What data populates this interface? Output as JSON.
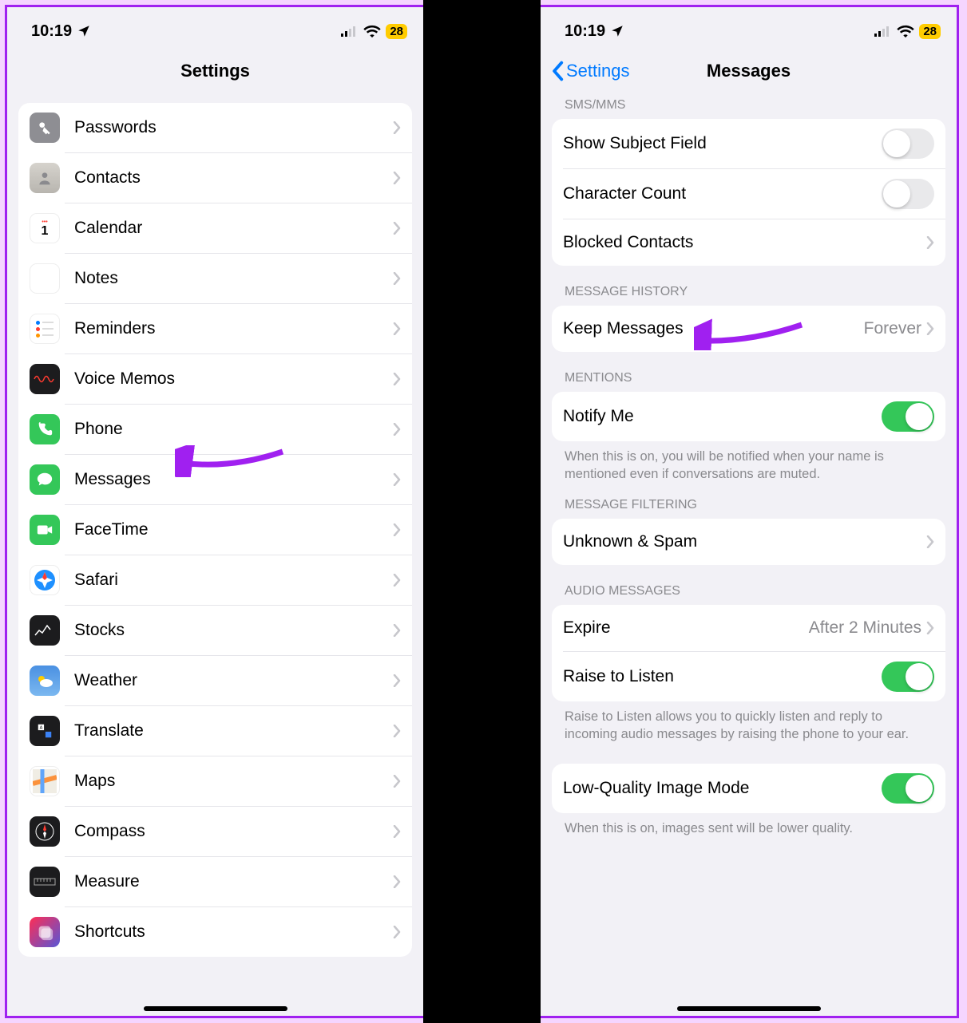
{
  "status": {
    "time": "10:19",
    "battery": "28"
  },
  "left": {
    "title": "Settings",
    "items": [
      {
        "id": "passwords",
        "label": "Passwords"
      },
      {
        "id": "contacts",
        "label": "Contacts"
      },
      {
        "id": "calendar",
        "label": "Calendar"
      },
      {
        "id": "notes",
        "label": "Notes"
      },
      {
        "id": "reminders",
        "label": "Reminders"
      },
      {
        "id": "voicememos",
        "label": "Voice Memos"
      },
      {
        "id": "phone",
        "label": "Phone"
      },
      {
        "id": "messages",
        "label": "Messages"
      },
      {
        "id": "facetime",
        "label": "FaceTime"
      },
      {
        "id": "safari",
        "label": "Safari"
      },
      {
        "id": "stocks",
        "label": "Stocks"
      },
      {
        "id": "weather",
        "label": "Weather"
      },
      {
        "id": "translate",
        "label": "Translate"
      },
      {
        "id": "maps",
        "label": "Maps"
      },
      {
        "id": "compass",
        "label": "Compass"
      },
      {
        "id": "measure",
        "label": "Measure"
      },
      {
        "id": "shortcuts",
        "label": "Shortcuts"
      }
    ]
  },
  "right": {
    "back": "Settings",
    "title": "Messages",
    "sections": {
      "smsmms": {
        "header": "SMS/MMS",
        "show_subject": "Show Subject Field",
        "char_count": "Character Count",
        "blocked": "Blocked Contacts"
      },
      "history": {
        "header": "MESSAGE HISTORY",
        "keep": "Keep Messages",
        "keep_value": "Forever"
      },
      "mentions": {
        "header": "MENTIONS",
        "notify": "Notify Me",
        "footer": "When this is on, you will be notified when your name is mentioned even if conversations are muted."
      },
      "filtering": {
        "header": "MESSAGE FILTERING",
        "unknown": "Unknown & Spam"
      },
      "audio": {
        "header": "AUDIO MESSAGES",
        "expire": "Expire",
        "expire_value": "After 2 Minutes",
        "raise": "Raise to Listen",
        "footer": "Raise to Listen allows you to quickly listen and reply to incoming audio messages by raising the phone to your ear."
      },
      "lowq": {
        "label": "Low-Quality Image Mode",
        "footer": "When this is on, images sent will be lower quality."
      }
    }
  }
}
